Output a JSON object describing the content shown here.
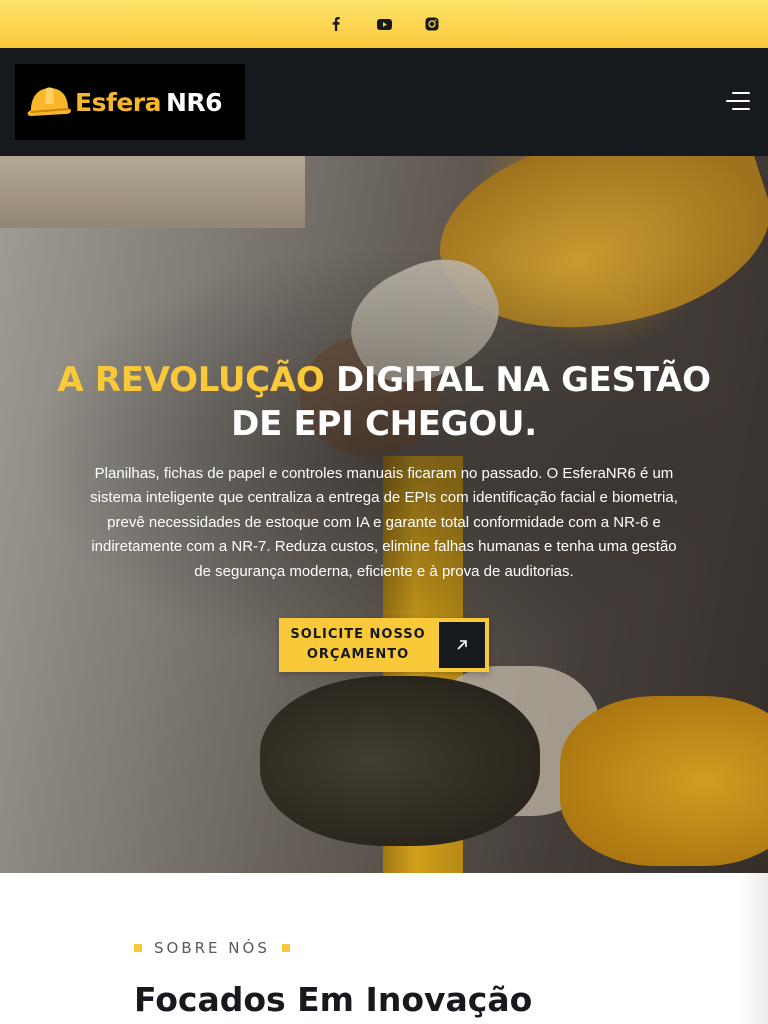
{
  "topbar": {
    "icons": [
      "facebook-icon",
      "youtube-icon",
      "instagram-icon"
    ],
    "background": "#f9c93a"
  },
  "header": {
    "logo": {
      "part1": "Esfera",
      "part2": "NR6"
    },
    "menu_icon": "hamburger-menu-icon",
    "background": "#16191d"
  },
  "hero": {
    "title_accent": "A REVOLUÇÃO",
    "title_rest": " DIGITAL NA GESTÃO DE EPI CHEGOU.",
    "description": "Planilhas, fichas de papel e controles manuais ficaram no passado. O EsferaNR6 é um sistema inteligente que centraliza a entrega de EPIs com identificação facial e biometria, prevê necessidades de estoque com IA e garante total conformidade com a NR-6 e indiretamente com a NR-7. Reduza custos, elimine falhas humanas e tenha uma gestão de segurança moderna, eficiente e à prova de auditorias.",
    "cta_label": "SOLICITE NOSSO ORÇAMENTO",
    "cta_icon": "arrow-up-right-icon",
    "accent_color": "#f9c93a"
  },
  "about": {
    "tag": "SOBRE NÓS",
    "title": "Focados Em Inovação"
  }
}
